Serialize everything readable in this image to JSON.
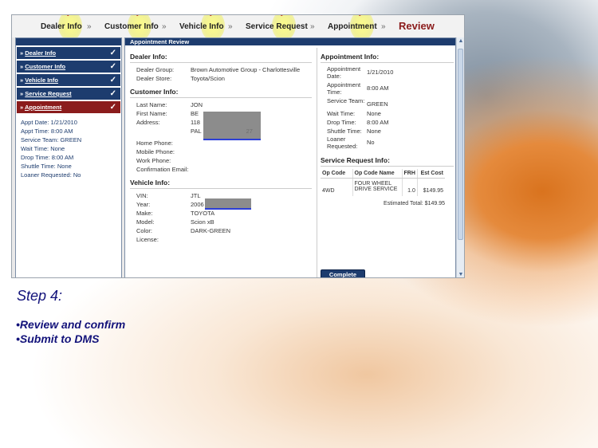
{
  "steps": [
    {
      "label": "Dealer Info",
      "done": true
    },
    {
      "label": "Customer Info",
      "done": true
    },
    {
      "label": "Vehicle Info",
      "done": true
    },
    {
      "label": "Service Request",
      "done": true
    },
    {
      "label": "Appointment",
      "done": true
    },
    {
      "label": "Review",
      "done": false
    }
  ],
  "separator": "»",
  "check_glyph": "✓",
  "sidebar": {
    "items": [
      {
        "label": "Dealer Info"
      },
      {
        "label": "Customer Info"
      },
      {
        "label": "Vehicle Info"
      },
      {
        "label": "Service Request"
      },
      {
        "label": "Appointment"
      }
    ],
    "prefix": "»",
    "summary": [
      "Appt Date: 1/21/2010",
      "Appt Time: 8:00 AM",
      "Service Team: GREEN",
      "Wait Time: None",
      "Drop Time: 8:00 AM",
      "Shuttle Time: None",
      "Loaner Requested: No"
    ]
  },
  "main": {
    "header": "Appointment Review",
    "dealer": {
      "title": "Dealer Info:",
      "group_label": "Dealer Group:",
      "group_value": "Brown Automotive Group - Charlottesville",
      "store_label": "Dealer Store:",
      "store_value": "Toyota/Scion"
    },
    "customer": {
      "title": "Customer Info:",
      "last_name_label": "Last Name:",
      "last_name_value": "JON",
      "first_name_label": "First Name:",
      "first_name_value": "BE",
      "address_label": "Address:",
      "address_line1": "118",
      "address_line2": "PAL",
      "address_tail": "27",
      "home_phone_label": "Home Phone:",
      "mobile_phone_label": "Mobile Phone:",
      "work_phone_label": "Work Phone:",
      "email_label": "Confirmation Email:"
    },
    "vehicle": {
      "title": "Vehicle Info:",
      "vin_label": "VIN:",
      "vin_value": "JTL",
      "year_label": "Year:",
      "year_value": "2006",
      "make_label": "Make:",
      "make_value": "TOYOTA",
      "model_label": "Model:",
      "model_value": "Scion xB",
      "color_label": "Color:",
      "color_value": "DARK-GREEN",
      "license_label": "License:"
    },
    "appointment": {
      "title": "Appointment Info:",
      "date_label": "Appointment Date:",
      "date_value": "1/21/2010",
      "time_label": "Appointment Time:",
      "time_value": "8:00 AM",
      "team_label": "Service Team:",
      "team_value": "GREEN",
      "wait_label": "Wait Time:",
      "wait_value": "None",
      "drop_label": "Drop Time:",
      "drop_value": "8:00 AM",
      "shuttle_label": "Shuttle Time:",
      "shuttle_value": "None",
      "loaner_label": "Loaner Requested:",
      "loaner_value": "No"
    },
    "service": {
      "title": "Service Request Info:",
      "columns": [
        "Op Code",
        "Op Code Name",
        "FRH",
        "Est Cost"
      ],
      "rows": [
        {
          "op_code": "4WD",
          "name": "FOUR WHEEL DRIVE SERVICE",
          "frh": "1.0",
          "cost": "$149.95"
        }
      ],
      "estimated_total_label": "Estimated Total:",
      "estimated_total_value": "$149.95"
    },
    "complete_label": "Complete"
  },
  "caption": {
    "title": "Step 4:",
    "bullets": [
      "•Review and confirm",
      "•Submit to DMS"
    ]
  },
  "colors": {
    "nav_blue": "#1d3c6e",
    "active_red": "#8b1c1c",
    "caption_blue": "#12127a",
    "check_highlight": "#f0f05a"
  }
}
